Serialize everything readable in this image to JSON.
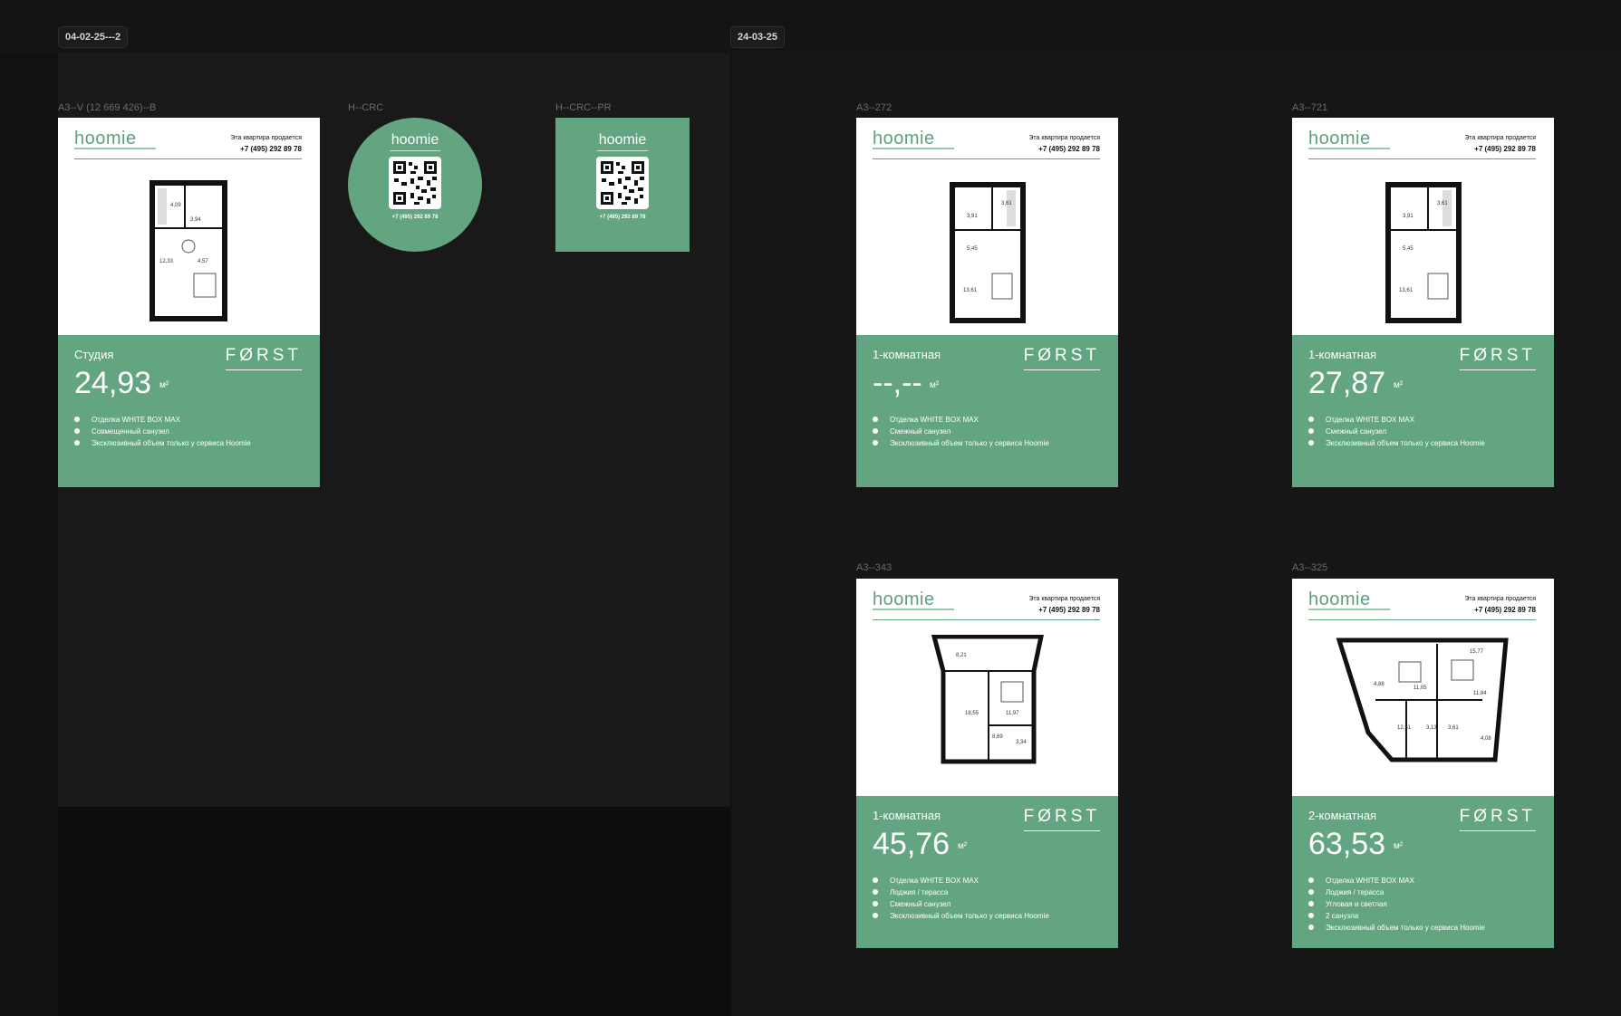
{
  "sections": [
    {
      "tag": "04-02-25---2"
    },
    {
      "tag": "24-03-25"
    }
  ],
  "frames": {
    "studio": {
      "label": "A3--V (12 669 426)--B",
      "brand": "hoomie",
      "contact_line1": "Эта квартира продается",
      "phone": "+7 (495) 292 89 78",
      "type": "Студия",
      "area": "24,93",
      "unit": "м²",
      "logo": "FØRST",
      "features": [
        "Отделка WHITE BOX MAX",
        "Совмещенный санузел",
        "Эксклюзивный объем только у сервиса Hoomie"
      ],
      "rooms": [
        "4,09",
        "3,94",
        "12,33",
        "4,57"
      ]
    },
    "qr_circle": {
      "label": "H--CRC",
      "brand": "hoomie",
      "phone": "+7 (495) 292 89 78"
    },
    "qr_square": {
      "label": "H--CRC--PR",
      "brand": "hoomie",
      "phone": "+7 (495) 292 89 78"
    },
    "a272": {
      "label": "A3--272",
      "brand": "hoomie",
      "contact_line1": "Эта квартира продается",
      "phone": "+7 (495) 292 89 78",
      "type": "1-комнатная",
      "area": "--,--",
      "unit": "м²",
      "logo": "FØRST",
      "features": [
        "Отделка WHITE BOX MAX",
        "Смежный санузел",
        "Эксклюзивный объем только у сервиса Hoomie"
      ],
      "rooms": [
        "3,61",
        "3,91",
        "5,45",
        "13,61"
      ]
    },
    "a721": {
      "label": "A3--721",
      "brand": "hoomie",
      "contact_line1": "Эта квартира продается",
      "phone": "+7 (495) 292 89 78",
      "type": "1-комнатная",
      "area": "27,87",
      "unit": "м²",
      "logo": "FØRST",
      "features": [
        "Отделка WHITE BOX MAX",
        "Смежный санузел",
        "Эксклюзивный объем только у сервиса Hoomie"
      ],
      "rooms": [
        "3,61",
        "3,91",
        "5,45",
        "13,61"
      ]
    },
    "a343": {
      "label": "A3--343",
      "brand": "hoomie",
      "contact_line1": "Эта квартира продается",
      "phone": "+7 (495) 292 89 78",
      "type": "1-комнатная",
      "area": "45,76",
      "unit": "м²",
      "logo": "FØRST",
      "features": [
        "Отделка WHITE BOX MAX",
        "Лоджия / терасса",
        "Смежный санузел",
        "Эксклюзивный объем только у сервиса Hoomie"
      ],
      "rooms": [
        "8,21",
        "18,55",
        "11,97",
        "8,69",
        "3,34"
      ]
    },
    "a325": {
      "label": "A3--325",
      "brand": "hoomie",
      "contact_line1": "Эта квартира продается",
      "phone": "+7 (495) 292 89 78",
      "type": "2-комнатная",
      "area": "63,53",
      "unit": "м²",
      "logo": "FØRST",
      "features": [
        "Отделка WHITE BOX MAX",
        "Лоджия / терасса",
        "Угловая и светлая",
        "2 санузла",
        "Эксклюзивный объем только у сервиса Hoomie"
      ],
      "rooms": [
        "15,77",
        "4,88",
        "11,05",
        "11,84",
        "12,51",
        "3,13",
        "3,61",
        "4,08"
      ]
    }
  }
}
